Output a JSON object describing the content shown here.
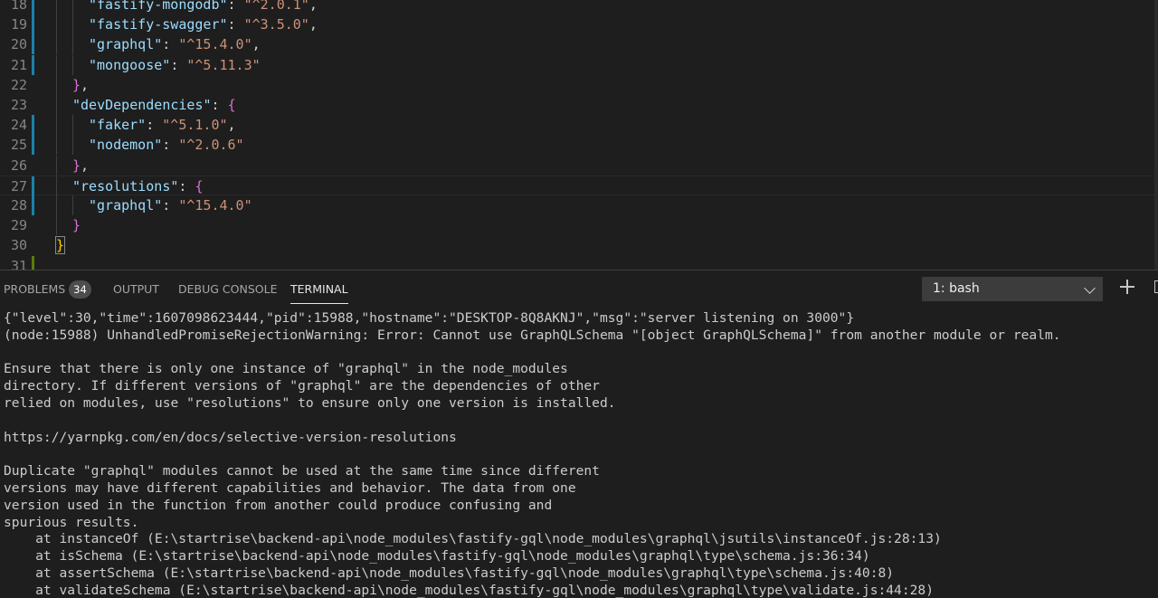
{
  "editor": {
    "lines": [
      {
        "n": "18",
        "marker": "mod",
        "indent": 2,
        "current": false,
        "tokens": [
          {
            "t": "\"fastify-mongodb\"",
            "c": "key"
          },
          {
            "t": ": ",
            "c": "punc"
          },
          {
            "t": "\"^2.0.1\"",
            "c": "str"
          },
          {
            "t": ",",
            "c": "punc"
          }
        ]
      },
      {
        "n": "19",
        "marker": "mod",
        "indent": 2,
        "current": false,
        "tokens": [
          {
            "t": "\"fastify-swagger\"",
            "c": "key"
          },
          {
            "t": ": ",
            "c": "punc"
          },
          {
            "t": "\"^3.5.0\"",
            "c": "str"
          },
          {
            "t": ",",
            "c": "punc"
          }
        ]
      },
      {
        "n": "20",
        "marker": "mod",
        "indent": 2,
        "current": false,
        "tokens": [
          {
            "t": "\"graphql\"",
            "c": "key"
          },
          {
            "t": ": ",
            "c": "punc"
          },
          {
            "t": "\"^15.4.0\"",
            "c": "str"
          },
          {
            "t": ",",
            "c": "punc"
          }
        ]
      },
      {
        "n": "21",
        "marker": "mod",
        "indent": 2,
        "current": false,
        "tokens": [
          {
            "t": "\"mongoose\"",
            "c": "key"
          },
          {
            "t": ": ",
            "c": "punc"
          },
          {
            "t": "\"^5.11.3\"",
            "c": "str"
          }
        ]
      },
      {
        "n": "22",
        "marker": "",
        "indent": 1,
        "current": false,
        "tokens": [
          {
            "t": "}",
            "c": "b2"
          },
          {
            "t": ",",
            "c": "punc"
          }
        ]
      },
      {
        "n": "23",
        "marker": "",
        "indent": 1,
        "current": false,
        "tokens": [
          {
            "t": "\"devDependencies\"",
            "c": "key"
          },
          {
            "t": ": ",
            "c": "punc"
          },
          {
            "t": "{",
            "c": "b2"
          }
        ]
      },
      {
        "n": "24",
        "marker": "mod",
        "indent": 2,
        "current": false,
        "tokens": [
          {
            "t": "\"faker\"",
            "c": "key"
          },
          {
            "t": ": ",
            "c": "punc"
          },
          {
            "t": "\"^5.1.0\"",
            "c": "str"
          },
          {
            "t": ",",
            "c": "punc"
          }
        ]
      },
      {
        "n": "25",
        "marker": "mod",
        "indent": 2,
        "current": false,
        "tokens": [
          {
            "t": "\"nodemon\"",
            "c": "key"
          },
          {
            "t": ": ",
            "c": "punc"
          },
          {
            "t": "\"^2.0.6\"",
            "c": "str"
          }
        ]
      },
      {
        "n": "26",
        "marker": "",
        "indent": 1,
        "current": false,
        "tokens": [
          {
            "t": "}",
            "c": "b2"
          },
          {
            "t": ",",
            "c": "punc"
          }
        ]
      },
      {
        "n": "27",
        "marker": "mod",
        "indent": 1,
        "current": true,
        "tokens": [
          {
            "t": "\"resolutions\"",
            "c": "key"
          },
          {
            "t": ": ",
            "c": "punc"
          },
          {
            "t": "{",
            "c": "b2"
          }
        ]
      },
      {
        "n": "28",
        "marker": "mod",
        "indent": 2,
        "current": false,
        "tokens": [
          {
            "t": "\"graphql\"",
            "c": "key"
          },
          {
            "t": ": ",
            "c": "punc"
          },
          {
            "t": "\"^15.4.0\"",
            "c": "str"
          }
        ]
      },
      {
        "n": "29",
        "marker": "",
        "indent": 1,
        "current": false,
        "tokens": [
          {
            "t": "}",
            "c": "b2"
          }
        ]
      },
      {
        "n": "30",
        "marker": "",
        "indent": 0,
        "current": false,
        "tokens": [
          {
            "t": "}",
            "c": "b1match"
          }
        ]
      },
      {
        "n": "31",
        "marker": "added",
        "indent": 0,
        "current": false,
        "tokens": []
      }
    ]
  },
  "panel": {
    "tabs": [
      {
        "label": "PROBLEMS",
        "active": false
      },
      {
        "label": "OUTPUT",
        "active": false
      },
      {
        "label": "DEBUG CONSOLE",
        "active": false
      },
      {
        "label": "TERMINAL",
        "active": true
      }
    ],
    "problems_count": "34",
    "terminal_select": "1: bash",
    "plus_icon": "plus-icon",
    "split_icon": "split-terminal-icon"
  },
  "terminal": {
    "lines": [
      "{\"level\":30,\"time\":1607098623444,\"pid\":15988,\"hostname\":\"DESKTOP-8Q8AKNJ\",\"msg\":\"server listening on 3000\"}",
      "(node:15988) UnhandledPromiseRejectionWarning: Error: Cannot use GraphQLSchema \"[object GraphQLSchema]\" from another module or realm.",
      "",
      "Ensure that there is only one instance of \"graphql\" in the node_modules",
      "directory. If different versions of \"graphql\" are the dependencies of other",
      "relied on modules, use \"resolutions\" to ensure only one version is installed.",
      "",
      "https://yarnpkg.com/en/docs/selective-version-resolutions",
      "",
      "Duplicate \"graphql\" modules cannot be used at the same time since different",
      "versions may have different capabilities and behavior. The data from one",
      "version used in the function from another could produce confusing and",
      "spurious results.",
      "    at instanceOf (E:\\startrise\\backend-api\\node_modules\\fastify-gql\\node_modules\\graphql\\jsutils\\instanceOf.js:28:13)",
      "    at isSchema (E:\\startrise\\backend-api\\node_modules\\fastify-gql\\node_modules\\graphql\\type\\schema.js:36:34)",
      "    at assertSchema (E:\\startrise\\backend-api\\node_modules\\fastify-gql\\node_modules\\graphql\\type\\schema.js:40:8)",
      "    at validateSchema (E:\\startrise\\backend-api\\node_modules\\fastify-gql\\node_modules\\graphql\\type\\validate.js:44:28)"
    ]
  },
  "colors": {
    "background": "#1e1e1e",
    "json_key": "#9cdcfe",
    "json_string": "#ce9178",
    "bracket_gold": "#ffd700",
    "bracket_orchid": "#da70d6",
    "modified_marker": "#1b81a8",
    "added_marker": "#587c0c"
  }
}
